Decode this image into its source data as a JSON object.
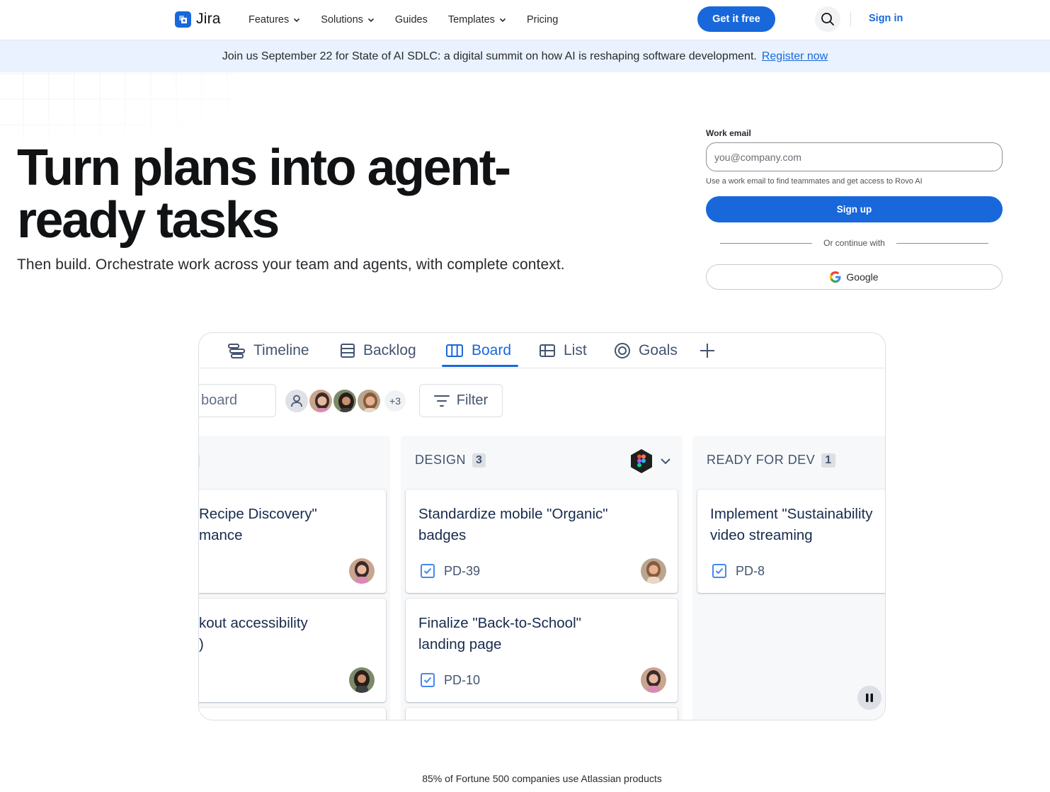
{
  "nav": {
    "brand": "Jira",
    "links": [
      "Features",
      "Solutions",
      "Guides",
      "Templates",
      "Pricing"
    ],
    "cta": "Get it free",
    "signin": "Sign in"
  },
  "banner": {
    "text": "Join us September 22 for State of AI SDLC: a digital summit on how AI is reshaping software development.",
    "link": "Register now"
  },
  "hero": {
    "title_line1": "Turn plans into agent-",
    "title_line2": "ready tasks",
    "subtitle": "Then build. Orchestrate work across your team and agents, with complete context."
  },
  "form": {
    "label": "Work email",
    "placeholder": "you@company.com",
    "help": "Use a work email to find teammates and get access to Rovo AI",
    "signup": "Sign up",
    "or": "Or continue with",
    "google": "Google"
  },
  "mock": {
    "tabs": [
      "Timeline",
      "Backlog",
      "Board",
      "List",
      "Goals"
    ],
    "active_tab": "Board",
    "search_placeholder": "board",
    "avatars_more": "+3",
    "filter": "Filter",
    "columns": [
      {
        "name": "",
        "count": "",
        "cards": [
          {
            "title1": "Recipe Discovery\"",
            "title2": "mance",
            "key": ""
          },
          {
            "title1": "kout accessibility",
            "title2": ")",
            "key": ""
          }
        ]
      },
      {
        "name": "DESIGN",
        "count": "3",
        "cards": [
          {
            "title1": "Standardize mobile \"Organic\"",
            "title2": "badges",
            "key": "PD-39"
          },
          {
            "title1": "Finalize \"Back-to-School\"",
            "title2": "landing page",
            "key": "PD-10"
          }
        ]
      },
      {
        "name": "READY FOR DEV",
        "count": "1",
        "cards": [
          {
            "title1": "Implement \"Sustainability",
            "title2": "video streaming",
            "key": "PD-8"
          }
        ]
      }
    ]
  },
  "footer_note": "85% of Fortune 500 companies use Atlassian products",
  "colors": {
    "brand_blue": "#1868db",
    "banner_bg": "#e9f2fe",
    "text_dark": "#101214"
  }
}
